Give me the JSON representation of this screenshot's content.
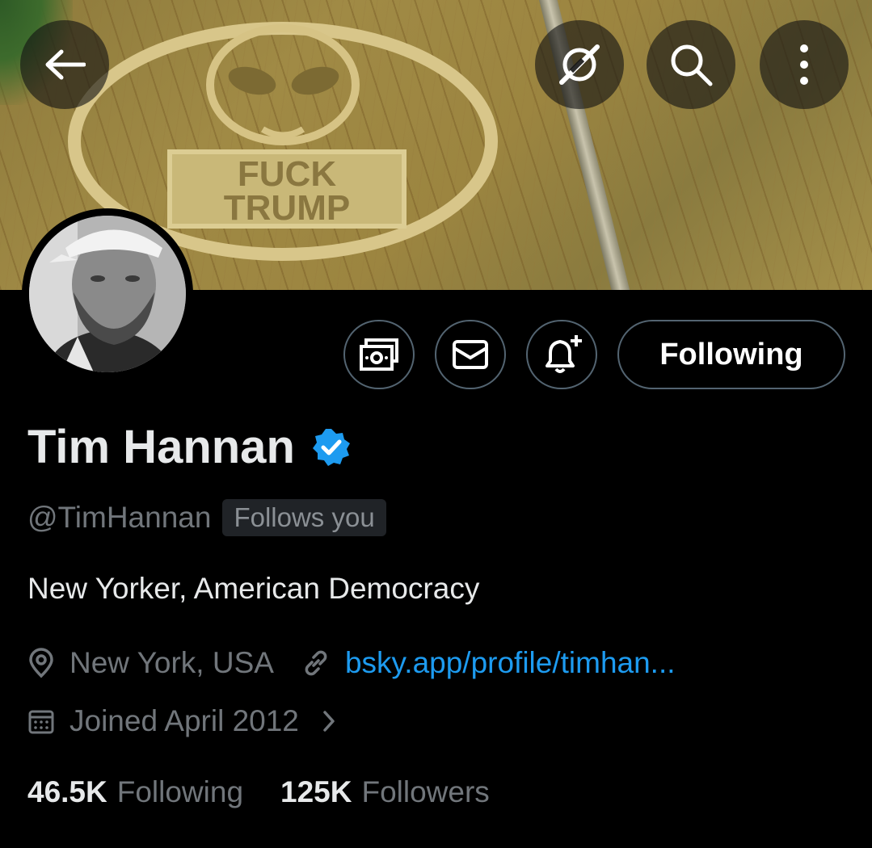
{
  "banner": {
    "crop_text_line1": "FUCK",
    "crop_text_line2": "TRUMP"
  },
  "header_buttons": {
    "back_icon": "arrow-left-icon",
    "grok_icon": "grok-icon",
    "search_icon": "search-icon",
    "more_icon": "more-vertical-icon"
  },
  "actions": {
    "subscribe_icon": "money-icon",
    "message_icon": "envelope-icon",
    "notify_icon": "bell-plus-icon",
    "following_label": "Following"
  },
  "profile": {
    "name": "Tim Hannan",
    "verified": true,
    "handle": "@TimHannan",
    "follows_you": "Follows you",
    "bio": "New Yorker, American Democracy",
    "location": "New York, USA",
    "website": "bsky.app/profile/timhan...",
    "joined": "Joined April 2012",
    "following_count": "46.5K",
    "following_label": "Following",
    "followers_count": "125K",
    "followers_label": "Followers"
  },
  "colors": {
    "background": "#000000",
    "primary_text": "#e7e9ea",
    "secondary_text": "#71767b",
    "link": "#1d9bf0",
    "verified_badge": "#1d9bf0",
    "border": "#536471"
  }
}
